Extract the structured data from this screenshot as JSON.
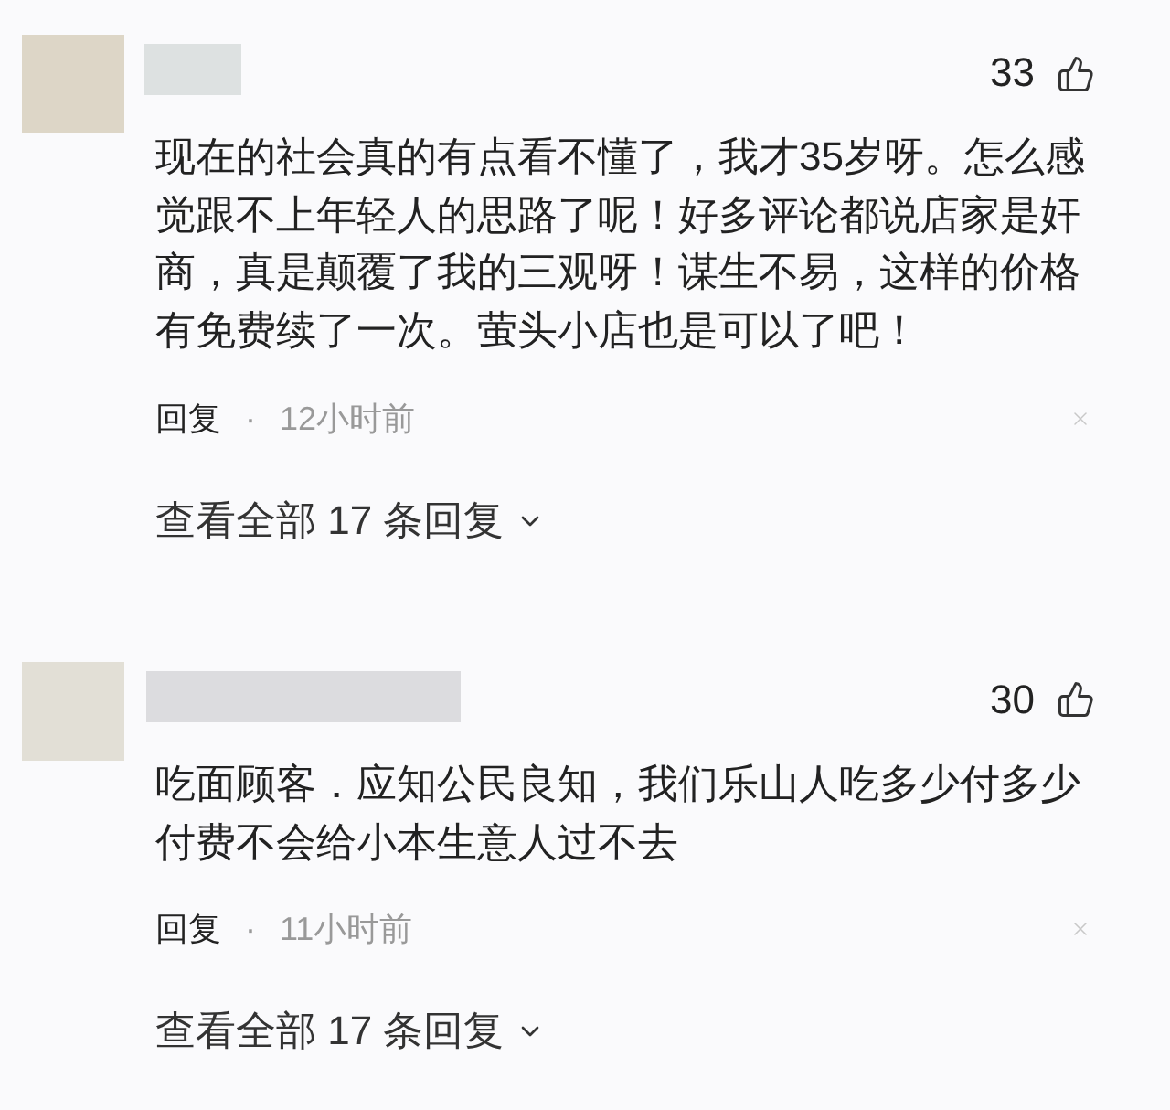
{
  "comments": [
    {
      "likes": "33",
      "text": "现在的社会真的有点看不懂了，我才35岁呀。怎么感觉跟不上年轻人的思路了呢！好多评论都说店家是奸商，真是颠覆了我的三观呀！谋生不易，这样的价格有免费续了一次。萤头小店也是可以了吧！",
      "reply": "回复",
      "separator": "·",
      "time": "12小时前",
      "view_replies": "查看全部 17 条回复"
    },
    {
      "likes": "30",
      "text": "吃面顾客．应知公民良知，我们乐山人吃多少付多少付费不会给小本生意人过不去",
      "reply": "回复",
      "separator": "·",
      "time": "11小时前",
      "view_replies": "查看全部 17 条回复"
    }
  ]
}
